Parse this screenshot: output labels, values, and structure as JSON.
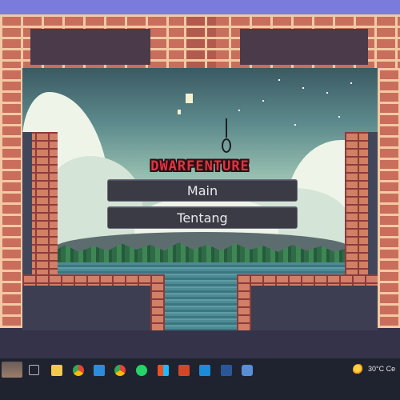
{
  "game": {
    "title": "DWARFENTURE",
    "menu": {
      "main_label": "Main",
      "about_label": "Tentang"
    }
  },
  "taskbar": {
    "icons": [
      "search-icon",
      "task-view-icon",
      "file-explorer-icon",
      "chrome-icon",
      "vscode-icon",
      "chrome-icon",
      "whatsapp-icon",
      "figma-icon",
      "powerpoint-icon",
      "photos-icon",
      "word-icon",
      "game-icon"
    ],
    "weather_text": "30°C Ce"
  },
  "colors": {
    "title_red": "#e3323f",
    "brick": "#c96e5c",
    "taskbar": "#1f2330"
  }
}
